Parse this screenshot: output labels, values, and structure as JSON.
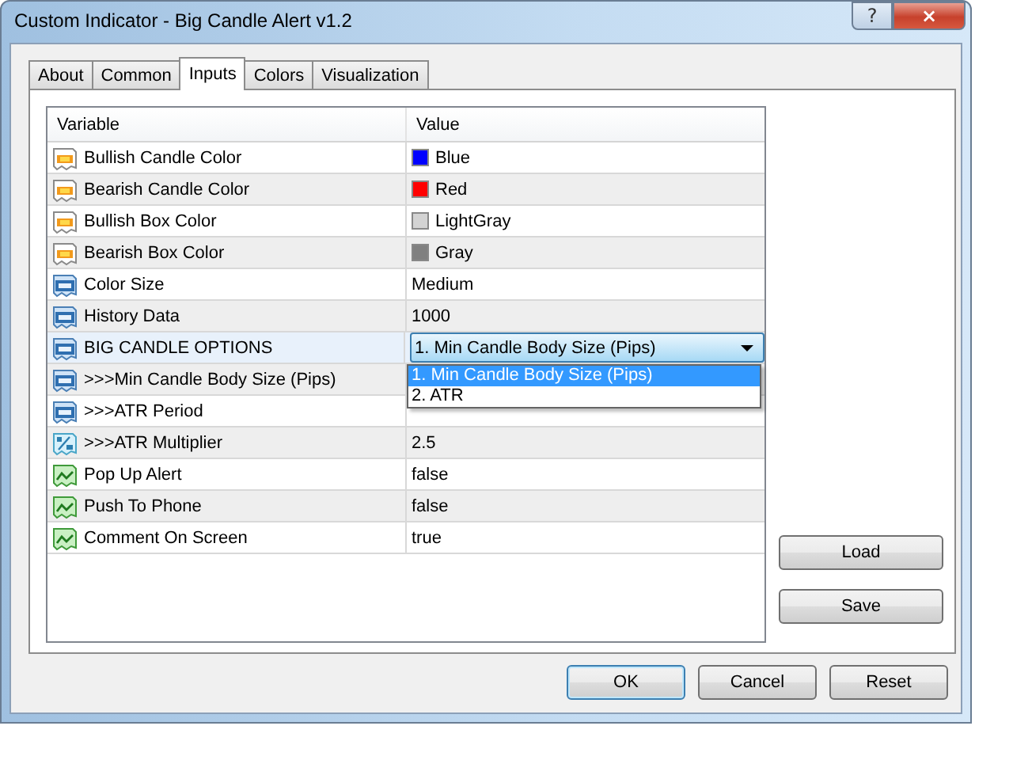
{
  "window": {
    "title": "Custom Indicator - Big Candle Alert v1.2",
    "help": "?",
    "close": "×"
  },
  "tabs": [
    {
      "label": "About",
      "selected": false
    },
    {
      "label": "Common",
      "selected": false
    },
    {
      "label": "Inputs",
      "selected": true
    },
    {
      "label": "Colors",
      "selected": false
    },
    {
      "label": "Visualization",
      "selected": false
    }
  ],
  "table": {
    "columns": [
      "Variable",
      "Value"
    ],
    "rows": [
      {
        "kind": "color",
        "variable": "Bullish Candle Color",
        "value": "Blue",
        "color": "#0000ff",
        "selected": false
      },
      {
        "kind": "color",
        "variable": "Bearish Candle Color",
        "value": "Red",
        "color": "#ff0000",
        "selected": false
      },
      {
        "kind": "color",
        "variable": "Bullish Box Color",
        "value": "LightGray",
        "color": "#d3d3d3",
        "selected": false
      },
      {
        "kind": "color",
        "variable": "Bearish Box Color",
        "value": "Gray",
        "color": "#808080",
        "selected": false
      },
      {
        "kind": "int",
        "variable": "Color Size",
        "value": "Medium",
        "selected": false
      },
      {
        "kind": "int",
        "variable": "History Data",
        "value": "1000",
        "selected": false
      },
      {
        "kind": "int",
        "variable": "BIG CANDLE OPTIONS",
        "value": "1. Min Candle Body Size (Pips)",
        "selected": true,
        "dropdown": {
          "options": [
            {
              "label": "1. Min Candle Body Size (Pips)",
              "selected": true
            },
            {
              "label": "2. ATR",
              "selected": false
            }
          ]
        }
      },
      {
        "kind": "int",
        "variable": ">>>Min Candle Body Size (Pips)",
        "selected": false
      },
      {
        "kind": "int",
        "variable": ">>>ATR Period",
        "selected": false
      },
      {
        "kind": "double",
        "variable": ">>>ATR Multiplier",
        "value": "2.5",
        "selected": false
      },
      {
        "kind": "bool",
        "variable": "Pop Up Alert",
        "value": "false",
        "selected": false
      },
      {
        "kind": "bool",
        "variable": "Push To Phone",
        "value": "false",
        "selected": false
      },
      {
        "kind": "bool",
        "variable": "Comment On Screen",
        "value": "true",
        "selected": false
      }
    ]
  },
  "side_buttons": [
    "Load",
    "Save"
  ],
  "buttons": [
    {
      "label": "OK",
      "default": true
    },
    {
      "label": "Cancel",
      "default": false
    },
    {
      "label": "Reset",
      "default": false
    }
  ]
}
